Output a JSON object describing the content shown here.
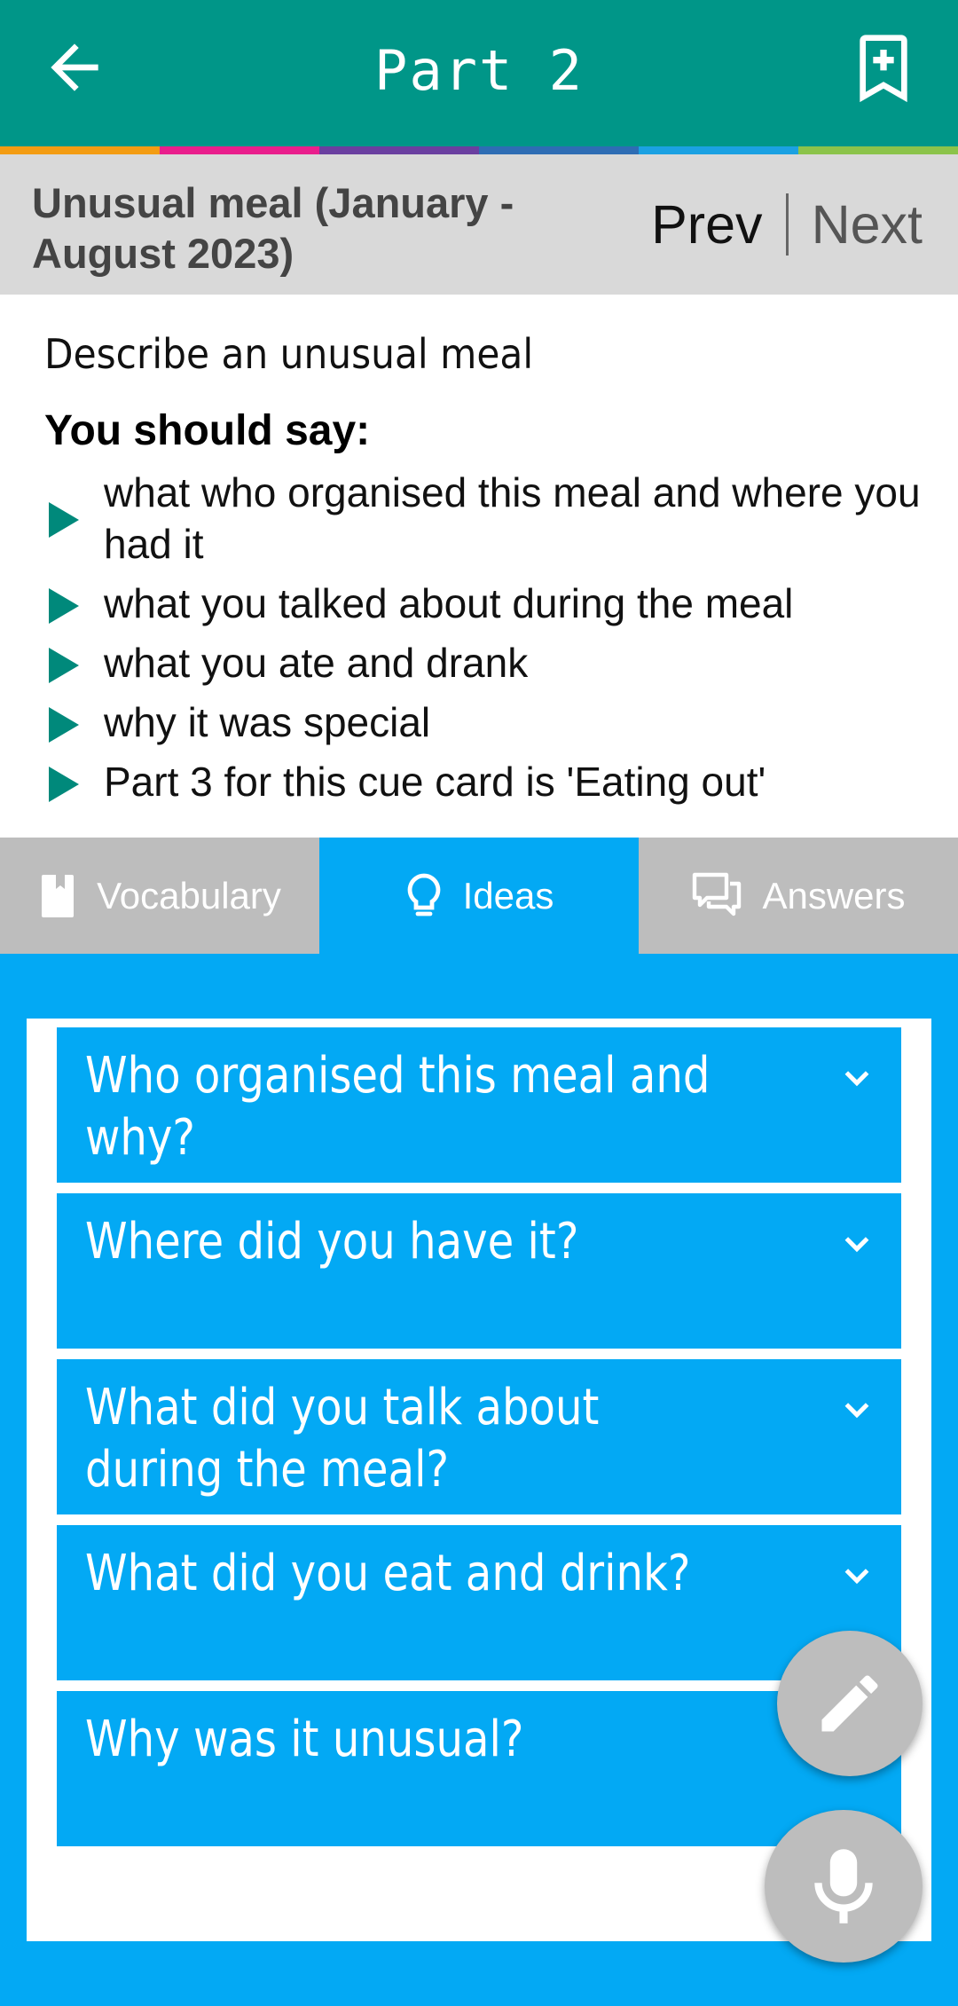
{
  "app_bar": {
    "title": "Part 2",
    "back_icon": "arrow-left-icon",
    "bookmark_icon": "bookmark-add-icon"
  },
  "colors": {
    "primary": "#009688",
    "accent": "#03A9F4",
    "stripe": [
      "#F39C12",
      "#E91E8C",
      "#6A3FA0",
      "#2E6DB4",
      "#1BA1E2",
      "#8BC34A"
    ]
  },
  "topic": {
    "title": "Unusual meal (January - August 2023)",
    "prev": "Prev",
    "next": "Next"
  },
  "cue_card": {
    "description": "Describe an unusual meal",
    "should_say": "You should say:",
    "points": [
      "what who organised this meal and where you had it",
      "what you talked about during the meal",
      "what you ate and drank",
      "why it was special",
      "Part 3 for this cue card is 'Eating out'"
    ]
  },
  "tabs": [
    {
      "label": "Vocabulary",
      "icon": "book-icon",
      "active": false
    },
    {
      "label": "Ideas",
      "icon": "lightbulb-icon",
      "active": true
    },
    {
      "label": "Answers",
      "icon": "chat-icon",
      "active": false
    }
  ],
  "ideas": [
    "Who organised this meal and why?",
    "Where did you have it?",
    "What did you talk about during the meal?",
    "What did you eat and drink?",
    "Why was it unusual?"
  ],
  "fabs": {
    "edit_icon": "pencil-icon",
    "mic_icon": "microphone-icon"
  }
}
